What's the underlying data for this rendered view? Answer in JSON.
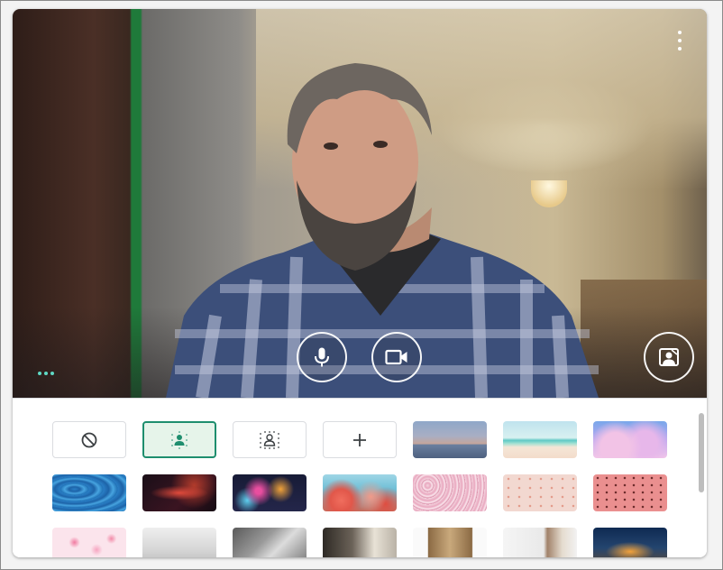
{
  "video": {
    "more_icon": "more-vert-icon",
    "mic_icon": "mic-icon",
    "camera_icon": "videocam-icon",
    "effects_icon": "background-replace-icon",
    "options_icon": "more-horiz-icon"
  },
  "picker": {
    "options": [
      {
        "name": "no-effect",
        "icon": "block-icon",
        "selected": false
      },
      {
        "name": "slight-blur",
        "icon": "blur-person-slight-icon",
        "selected": true
      },
      {
        "name": "blur",
        "icon": "blur-person-icon",
        "selected": false
      },
      {
        "name": "add-background",
        "icon": "plus-icon",
        "selected": false
      }
    ],
    "backgrounds": [
      "sunset",
      "beach",
      "clouds",
      "water",
      "nebula",
      "fireworks",
      "flowers",
      "pink-flowers",
      "pink-dots",
      "red-grid",
      "petals",
      "white-room",
      "grey-room",
      "dark-room",
      "bookshelf",
      "bright-room",
      "night-house"
    ]
  },
  "colors": {
    "accent": "#1e8e6e",
    "selected_fill": "#e6f4ea",
    "teal_dots": "#5fd8c4"
  }
}
